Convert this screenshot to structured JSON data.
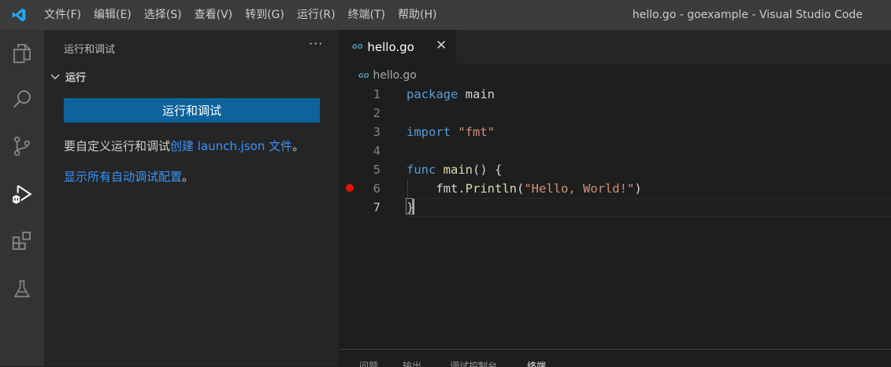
{
  "titlebar": {
    "menus": [
      "文件(F)",
      "编辑(E)",
      "选择(S)",
      "查看(V)",
      "转到(G)",
      "运行(R)",
      "终端(T)",
      "帮助(H)"
    ],
    "window_title": "hello.go - goexample - Visual Studio Code"
  },
  "activity_bar": {
    "icons": [
      "explorer-icon",
      "search-icon",
      "source-control-icon",
      "run-debug-icon",
      "extensions-icon",
      "testing-icon"
    ],
    "active": "run-debug-icon"
  },
  "sidebar": {
    "title": "运行和调试",
    "more": "···",
    "section": "运行",
    "run_button": "运行和调试",
    "customize_prefix": "要自定义运行和调试",
    "customize_link": "创建 launch.json 文件",
    "customize_suffix": "。",
    "show_all_link": "显示所有自动调试配置",
    "show_all_suffix": "。"
  },
  "editor": {
    "tab_label": "hello.go",
    "tab_close": "✕",
    "breadcrumb": "hello.go",
    "go_icon_text": "GO",
    "lines": [
      {
        "n": "1",
        "tokens": [
          {
            "t": "package",
            "c": "kw"
          },
          {
            "t": " ",
            "c": "id"
          },
          {
            "t": "main",
            "c": "id"
          }
        ]
      },
      {
        "n": "2",
        "tokens": []
      },
      {
        "n": "3",
        "tokens": [
          {
            "t": "import",
            "c": "kw"
          },
          {
            "t": " ",
            "c": "id"
          },
          {
            "t": "\"fmt\"",
            "c": "str"
          }
        ]
      },
      {
        "n": "4",
        "tokens": []
      },
      {
        "n": "5",
        "tokens": [
          {
            "t": "func",
            "c": "kw"
          },
          {
            "t": " ",
            "c": "id"
          },
          {
            "t": "main",
            "c": "fn"
          },
          {
            "t": "() {",
            "c": "id"
          }
        ]
      },
      {
        "n": "6",
        "tokens": [
          {
            "t": "    fmt.",
            "c": "id"
          },
          {
            "t": "Println",
            "c": "fn"
          },
          {
            "t": "(",
            "c": "id"
          },
          {
            "t": "\"Hello, World!\"",
            "c": "str"
          },
          {
            "t": ")",
            "c": "id"
          }
        ]
      },
      {
        "n": "7",
        "tokens": [
          {
            "t": "}",
            "c": "id"
          }
        ]
      }
    ],
    "current_line": "7",
    "breakpoint_line": "6"
  },
  "panel": {
    "tabs": [
      "问题",
      "输出",
      "调试控制台",
      "终端"
    ],
    "active": "终端"
  },
  "colors": {
    "accent": "#0e639c",
    "link": "#3794ff",
    "breakpoint": "#e51400"
  }
}
